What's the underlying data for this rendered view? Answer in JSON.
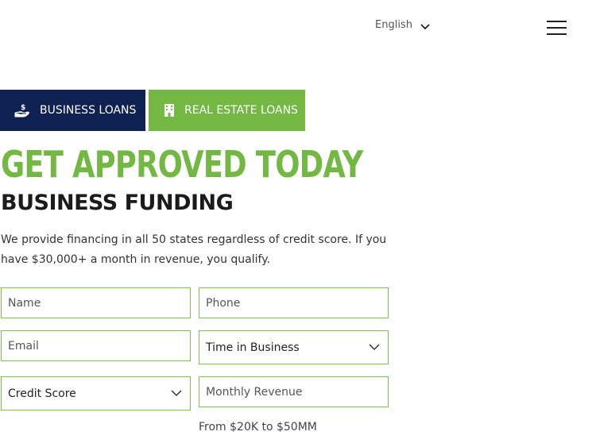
{
  "header": {
    "language": "English",
    "language_caret_icon": "chevron-down-icon",
    "menu_icon": "hamburger-menu-icon"
  },
  "tabs": [
    {
      "label": "BUSINESS LOANS",
      "icon": "hand-dollar-icon",
      "active": true,
      "color": "#0e2150"
    },
    {
      "label": "REAL ESTATE LOANS",
      "icon": "building-icon",
      "active": false,
      "color": "#72b843"
    }
  ],
  "hero": {
    "headline": "GET APPROVED TODAY",
    "subheadline": "BUSINESS FUNDING",
    "description": "We provide financing in all 50 states regardless of credit score. If you have $30,000+ a month in revenue, you qualify."
  },
  "form": {
    "name_placeholder": "Name",
    "phone_placeholder": "Phone",
    "email_placeholder": "Email",
    "time_in_business_label": "Time in Business",
    "credit_score_label": "Credit Score",
    "monthly_revenue_placeholder": "Monthly Revenue",
    "revenue_hint": "From $20K to $50MM"
  },
  "colors": {
    "brand_green": "#72b843",
    "brand_navy": "#0e2150",
    "field_border": "#7cbf52"
  }
}
